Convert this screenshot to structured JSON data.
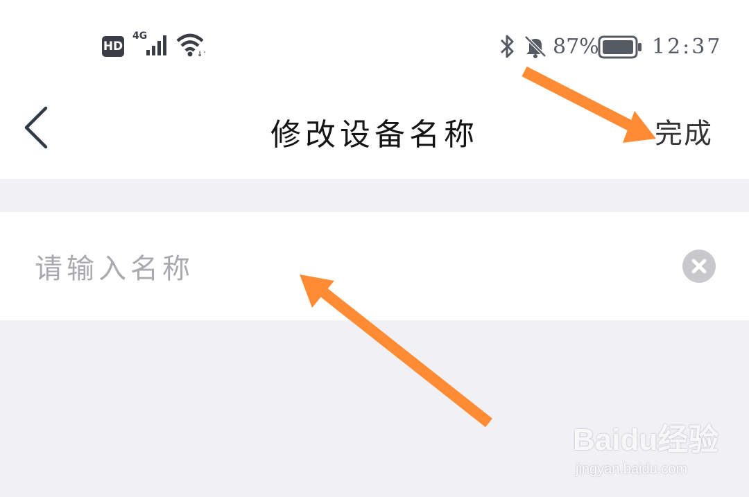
{
  "status_bar": {
    "hd_badge": "HD",
    "network": "4G",
    "battery_percent": "87%",
    "time": "12:37",
    "icons": [
      "signal-icon",
      "wifi-icon",
      "bluetooth-icon",
      "bell-muted-icon",
      "battery-icon"
    ]
  },
  "nav": {
    "back_icon": "chevron-left-icon",
    "title": "修改设备名称",
    "done_label": "完成"
  },
  "form": {
    "name_value": "",
    "name_placeholder": "请输入名称",
    "clear_icon": "close-circle-icon"
  },
  "overlay": {
    "annotation_color": "#FF8C34",
    "arrows": [
      "arrow-to-done",
      "arrow-to-input"
    ]
  },
  "watermark": {
    "logo_text": "Baidu经验",
    "url": "jingyan.baidu.com"
  },
  "colors": {
    "background": "#f1f0f5",
    "surface": "#ffffff",
    "accent_arrow": "#FF8C34"
  }
}
